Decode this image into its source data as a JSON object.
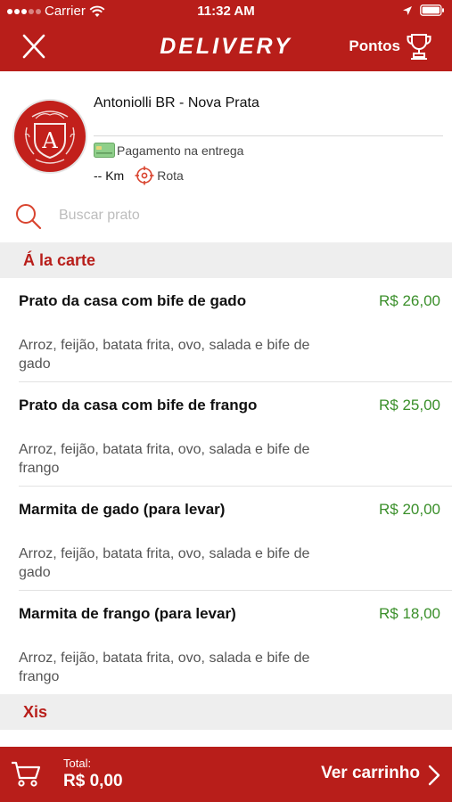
{
  "status_bar": {
    "carrier": "Carrier",
    "time": "11:32 AM",
    "icons": [
      "signal-dots-icon",
      "wifi-icon",
      "location-arrow-icon",
      "battery-icon"
    ]
  },
  "nav": {
    "close_icon": "close-icon",
    "title": "DELIVERY",
    "pontos_label": "Pontos",
    "pontos_icon": "trophy-icon"
  },
  "store": {
    "name": "Antoniolli BR - Nova Prata",
    "logo_letter": "A",
    "payment": "Pagamento na entrega",
    "distance": "-- Km",
    "rota": "Rota"
  },
  "search": {
    "placeholder": "Buscar prato",
    "value": ""
  },
  "menu": {
    "sections": [
      {
        "title": "Á la carte",
        "items": [
          {
            "name": "Prato da casa com bife de gado",
            "price": "R$ 26,00",
            "description": "Arroz, feijão, batata frita, ovo, salada e bife de gado"
          },
          {
            "name": "Prato da casa com bife de frango",
            "price": "R$ 25,00",
            "description": "Arroz, feijão, batata frita, ovo, salada e bife de frango"
          },
          {
            "name": "Marmita de gado (para levar)",
            "price": "R$ 20,00",
            "description": "Arroz, feijão, batata frita, ovo, salada e bife de gado"
          },
          {
            "name": "Marmita de frango (para levar)",
            "price": "R$ 18,00",
            "description": "Arroz, feijão, batata frita, ovo, salada e bife de frango"
          }
        ]
      },
      {
        "title": "Xis",
        "items": []
      }
    ]
  },
  "cart": {
    "total_label": "Total:",
    "total_value": "R$ 0,00",
    "cta": "Ver carrinho"
  },
  "colors": {
    "brand_red": "#b81e1a",
    "price_green": "#3a8f2a",
    "section_bg": "#eeeeee"
  }
}
